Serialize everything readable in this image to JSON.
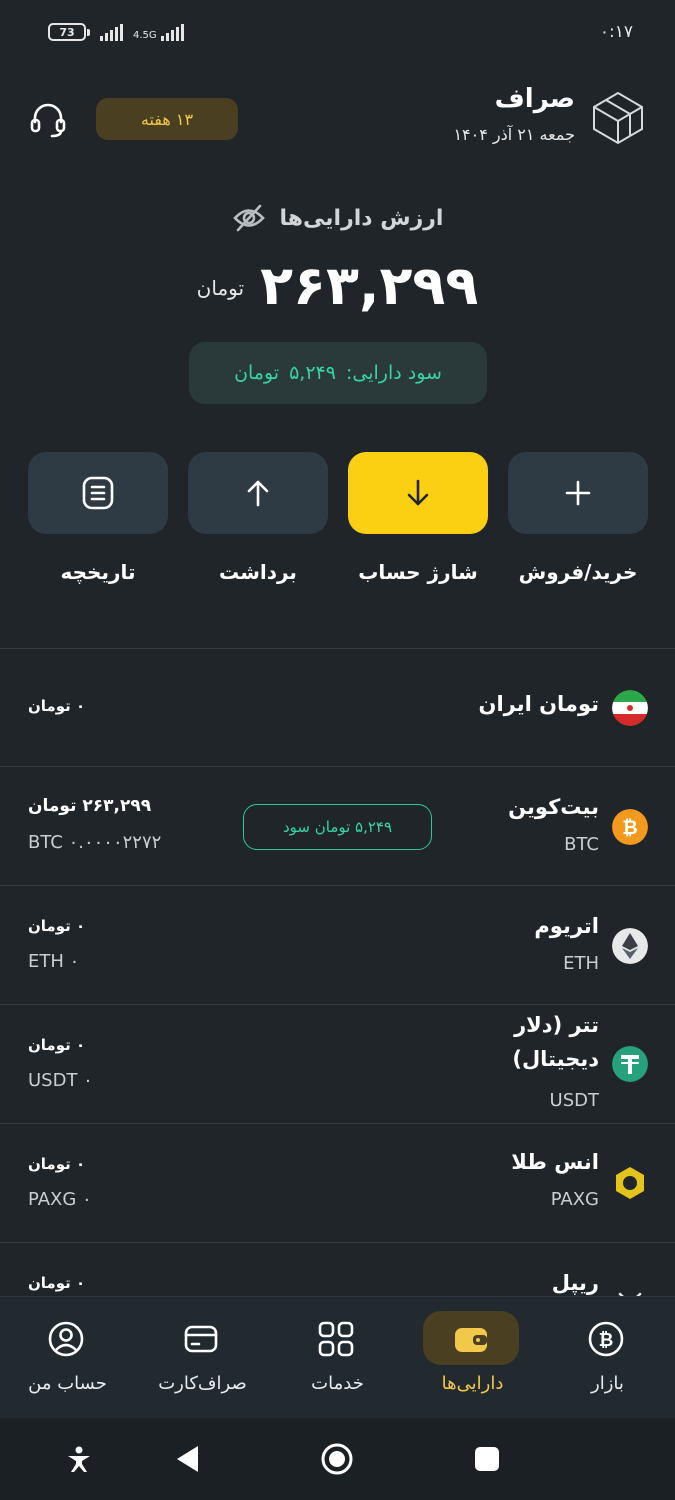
{
  "status_bar": {
    "time": "۰:۱۷",
    "battery": "73",
    "network": "4.5G"
  },
  "header": {
    "app_name": "صراف",
    "date": "جمعه ۲۱ آذر ۱۴۰۴",
    "week_badge": "۱۳ هفته",
    "icons": {
      "logo": "cube-logo-icon",
      "support": "headset-icon"
    }
  },
  "summary": {
    "title": "ارزش دارایی‌ها",
    "total_value": "۲۶۳,۲۹۹",
    "unit": "تومان",
    "profit_label": "سود دارایی:",
    "profit_value": "۵,۲۴۹",
    "profit_unit": "تومان"
  },
  "actions": [
    {
      "label": "خرید/فروش",
      "icon": "plus-icon"
    },
    {
      "label": "شارژ حساب",
      "icon": "arrow-down-icon"
    },
    {
      "label": "برداشت",
      "icon": "arrow-up-icon"
    },
    {
      "label": "تاریخچه",
      "icon": "history-icon"
    }
  ],
  "assets": [
    {
      "name": "تومان ایران",
      "symbol": "",
      "toman": "۰ تومان",
      "qty": "",
      "profit": "",
      "icon": "iran-flag-icon"
    },
    {
      "name": "بیت‌کوین",
      "symbol": "BTC",
      "toman": "۲۶۳,۲۹۹ تومان",
      "qty": "BTC ۰.۰۰۰۰۲۲۷۲",
      "profit": "۵,۲۴۹ تومان سود",
      "icon": "bitcoin-icon"
    },
    {
      "name": "اتریوم",
      "symbol": "ETH",
      "toman": "۰ تومان",
      "qty": "ETH ۰",
      "profit": "",
      "icon": "ethereum-icon"
    },
    {
      "name": "تتر (دلار دیجیتال)",
      "symbol": "USDT",
      "toman": "۰ تومان",
      "qty": "USDT ۰",
      "profit": "",
      "icon": "tether-icon"
    },
    {
      "name": "انس طلا",
      "symbol": "PAXG",
      "toman": "۰ تومان",
      "qty": "PAXG ۰",
      "profit": "",
      "icon": "paxg-icon"
    },
    {
      "name": "ریپل",
      "symbol": "",
      "toman": "۰ تومان",
      "qty": "",
      "profit": "",
      "icon": "ripple-icon"
    }
  ],
  "bottom_nav": [
    {
      "label": "بازار",
      "icon": "bitcoin-circle-icon",
      "active": false
    },
    {
      "label": "دارایی‌ها",
      "icon": "wallet-icon",
      "active": true
    },
    {
      "label": "خدمات",
      "icon": "grid-icon",
      "active": false
    },
    {
      "label": "صراف‌کارت",
      "icon": "card-icon",
      "active": false
    },
    {
      "label": "حساب من",
      "icon": "user-icon",
      "active": false
    }
  ],
  "colors": {
    "background": "#1f2529",
    "accent": "#fcd012",
    "profit": "#38d3a3",
    "badge_bg": "#4b3f22"
  }
}
